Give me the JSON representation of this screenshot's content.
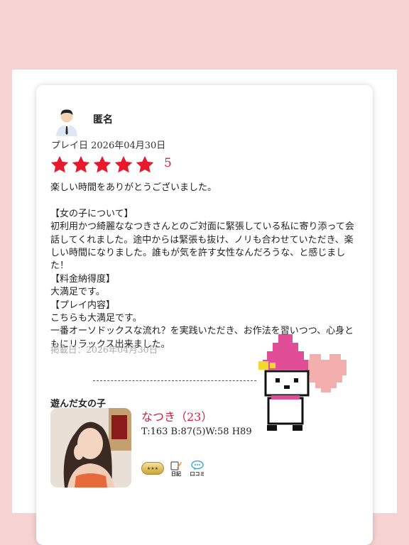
{
  "review": {
    "reviewer_name": "匿名",
    "play_date": "プレイ日 2026年04月30日",
    "rating_value": "5",
    "star_count": 5,
    "body": "楽しい時間をありがとうございました。\n\n【女の子について】\n初利用かつ綺麗ななつきさんとのご対面に緊張している私に寄り添って会話してくれました。途中からは緊張も抜け、ノリも合わせていただき、楽しい時間になりました。誰もが気を許す女性なんだろうな、と感じました！\n【料金納得度】\n大満足です。\n【プレイ内容】\nこちらも大満足です。\n一番オーソドックスな流れ？を実践いただき、お作法を習いつつ、心身ともにリラックス出来ました。",
    "posted_date": "掲載日：2026年04月30日"
  },
  "girl": {
    "section_label": "遊んだ女の子",
    "name": "なつき（23）",
    "stats": "T:163 B:87(5)W:58 H89",
    "badges": {
      "diary_label": "日記",
      "kuchikomi_label": "口コミ"
    }
  },
  "colors": {
    "background": "#f6d2d2",
    "accent_red": "#d81e3c",
    "star_red": "#e8192c",
    "muted_gray": "#aaaaaa"
  },
  "icons": [
    "user-avatar-icon",
    "star-icon",
    "diary-icon",
    "kuchikomi-icon",
    "gold-rank-badge",
    "pixel-melody-sticker"
  ]
}
